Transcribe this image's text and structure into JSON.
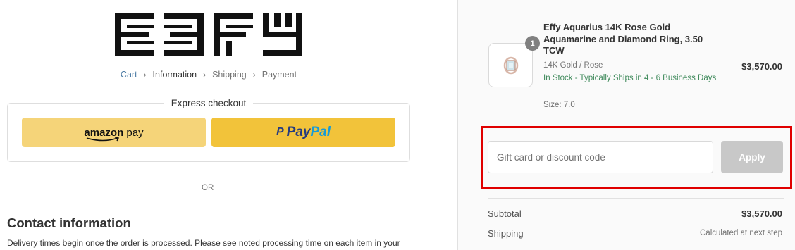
{
  "brand": {
    "logo_text": "EFFY"
  },
  "breadcrumb": {
    "cart": "Cart",
    "information": "Information",
    "shipping": "Shipping",
    "payment": "Payment"
  },
  "express_checkout": {
    "title": "Express checkout",
    "amazon_label_bold": "amazon",
    "amazon_label_rest": " pay",
    "paypal_pay": "Pay",
    "paypal_pal": "Pal"
  },
  "divider": {
    "or": "OR"
  },
  "contact": {
    "title": "Contact information",
    "note": "Delivery times begin once the order is processed. Please see noted processing time on each item in your"
  },
  "product": {
    "quantity_badge": "1",
    "name": "Effy Aquarius 14K Rose Gold Aquamarine and Diamond Ring, 3.50 TCW",
    "variant": "14K Gold / Rose",
    "stock": "In Stock - Typically Ships in 4 - 6 Business Days",
    "price": "$3,570.00",
    "size": "Size: 7.0"
  },
  "discount": {
    "placeholder": "Gift card or discount code",
    "apply_label": "Apply"
  },
  "summary": {
    "subtotal_label": "Subtotal",
    "subtotal_value": "$3,570.00",
    "shipping_label": "Shipping",
    "shipping_value": "Calculated at next step"
  },
  "colors": {
    "highlight": "#e00000",
    "amazon_button": "#f5d479",
    "paypal_button": "#f2c33a",
    "link": "#4a7aa3",
    "stock_green": "#3f8a5b"
  }
}
